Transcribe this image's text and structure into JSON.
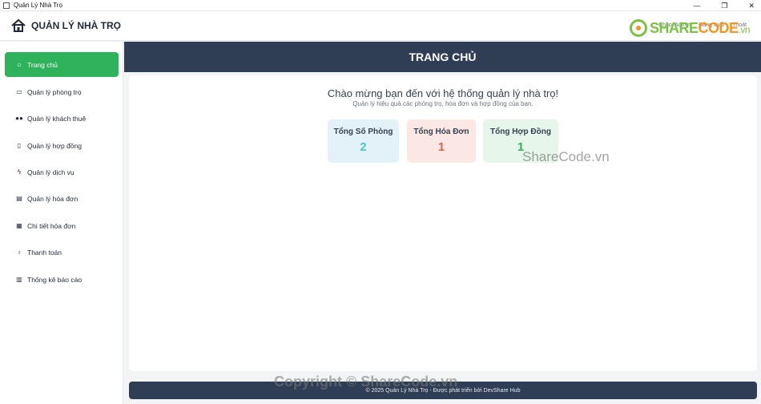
{
  "window": {
    "title": "Quản Lý Nhà Trọ",
    "controls": [
      "—",
      "❐",
      "✕"
    ]
  },
  "header": {
    "brand": "QUẢN LÝ NHÀ TRỌ",
    "links": [
      "Chào, Admin",
      "Đăng xuất",
      "Thoát"
    ],
    "watermark_logo": {
      "part1": "SHARE",
      "part2": "CODE",
      "part3": ".vn"
    }
  },
  "sidebar": {
    "items": [
      {
        "icon": "home-icon",
        "label": "Trang chủ",
        "active": true
      },
      {
        "icon": "bed-icon",
        "label": "Quản lý phòng trọ"
      },
      {
        "icon": "users-icon",
        "label": "Quản lý khách thuê"
      },
      {
        "icon": "document-icon",
        "label": "Quản lý hợp đồng"
      },
      {
        "icon": "bolt-icon",
        "label": "Quản lý dịch vụ"
      },
      {
        "icon": "receipt-icon",
        "label": "Quản lý hóa đơn"
      },
      {
        "icon": "clipboard-icon",
        "label": "Chi tiết hóa đơn"
      },
      {
        "icon": "money-bag-icon",
        "label": "Thanh toán"
      },
      {
        "icon": "bar-chart-icon",
        "label": "Thống kê báo cáo"
      }
    ]
  },
  "main": {
    "page_title": "TRANG CHỦ",
    "welcome": "Chào mừng bạn đến với hệ thống quản lý nhà trọ!",
    "subtitle": "Quản lý hiệu quả các phòng trọ, hóa đơn và hợp đồng của bạn.",
    "stats": [
      {
        "label": "Tổng Số Phòng",
        "value": "2",
        "color": "#4fc1c6"
      },
      {
        "label": "Tổng Hóa Đơn",
        "value": "1",
        "color": "#e0605a"
      },
      {
        "label": "Tổng Hợp Đồng",
        "value": "1",
        "color": "#2eb35c"
      }
    ],
    "watermark": "ShareCode.vn"
  },
  "footer": {
    "text": "© 2025 Quản Lý Nhà Trọ - Được phát triển bởi DevShare Hub",
    "watermark": "Copyright © ShareCode.vn"
  },
  "colors": {
    "accent": "#2eb35c",
    "band": "#2f3e55"
  }
}
